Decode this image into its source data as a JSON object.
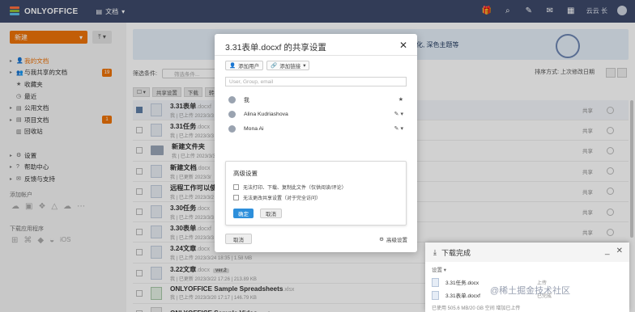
{
  "topbar": {
    "logo": "ONLYOFFICE",
    "module": "文档",
    "user": "云云 长"
  },
  "sidebar": {
    "new_button": "新建",
    "items": [
      {
        "label": "我的文档",
        "active": true,
        "arrow": "▸",
        "icon": "👤"
      },
      {
        "label": "与我共享的文档",
        "badge": "19",
        "arrow": "▸",
        "icon": "👥"
      },
      {
        "label": "收藏夹",
        "arrow": "",
        "icon": "★"
      },
      {
        "label": "最近",
        "arrow": "",
        "icon": "◷"
      },
      {
        "label": "公用文档",
        "arrow": "▸",
        "icon": "▤"
      },
      {
        "label": "项目文档",
        "badge": "1",
        "arrow": "▸",
        "icon": "▤"
      },
      {
        "label": "回收站",
        "arrow": "",
        "icon": "▥"
      },
      {
        "label": "",
        "arrow": "",
        "icon": ""
      },
      {
        "label": "设置",
        "arrow": "▸",
        "icon": "⚙"
      },
      {
        "label": "帮助中心",
        "arrow": "▸",
        "icon": "?"
      },
      {
        "label": "反馈与支持",
        "arrow": "▸",
        "icon": "✉"
      }
    ],
    "add_account_title": "添加帐户",
    "download_apps_title": "下载应用程序"
  },
  "banner": {
    "text": "化, 深色主题等"
  },
  "filter": {
    "label": "筛选条件:",
    "placeholder": "筛选条件...",
    "sort": "排序方式: 上次修改日期"
  },
  "toolbar": [
    "",
    "共享设置",
    "下载",
    "转换"
  ],
  "files": [
    {
      "name": "3.31表单",
      "ext": ".docxf",
      "meta": "我 | 已上传 2023/3/3",
      "share": "共享",
      "type": "doc",
      "selected": true
    },
    {
      "name": "3.31任务",
      "ext": ".docx",
      "meta": "我 | 已上传 2023/3/3",
      "share": "共享",
      "type": "doc"
    },
    {
      "name": "新建文件夹",
      "ext": "",
      "meta": "我 | 已上传 2023/3/3",
      "share": "共享",
      "type": "folder"
    },
    {
      "name": "新建文档",
      "ext": ".docx",
      "meta": "我 | 已更新 2023/3/",
      "share": "共享",
      "type": "doc"
    },
    {
      "name": "远程工作可以使",
      "ext": "",
      "meta": "我 | 已上传 2023/3/2",
      "share": "共享",
      "type": "doc"
    },
    {
      "name": "3.30任务",
      "ext": ".docx",
      "meta": "我 | 已上传 2023/3/3",
      "share": "共享",
      "type": "doc"
    },
    {
      "name": "3.30表单",
      "ext": ".docxf",
      "meta": "我 | 已上传 2023/3/3",
      "share": "共享",
      "type": "doc"
    },
    {
      "name": "3.24文章",
      "ext": ".docx",
      "meta": "我 | 已上传 2023/3/24 18:35 | 1.58 MB",
      "share": "共享",
      "type": "doc"
    },
    {
      "name": "3.22文章",
      "ext": ".docx",
      "meta": "我 | 已更新 2023/3/22 17:26 | 213.89 KB",
      "share": "共享",
      "type": "doc",
      "ver": "ver.2"
    },
    {
      "name": "ONLYOFFICE Sample Spreadsheets",
      "ext": ".xlsx",
      "meta": "我 | 已上传 2023/3/20 17:17 | 146.79 KB",
      "share": "共享",
      "type": "sheet"
    },
    {
      "name": "ONLYOFFICE Sample Video",
      "ext": ".mp4",
      "meta": "",
      "share": "",
      "type": "video"
    }
  ],
  "dialog": {
    "title": "3.31表单.docxf 的共享设置",
    "add_user": "添加用户",
    "add_link": "添加链接",
    "input_placeholder": "User, Group, email",
    "people": [
      {
        "name": "我",
        "right": "★"
      },
      {
        "name": "Alina Kudriashova",
        "right": "✎ ▾"
      },
      {
        "name": "Mona Ai",
        "right": "✎ ▾"
      }
    ],
    "advanced": {
      "title": "高级设置",
      "opt1": "无法打印、下载、复制此文件（仅供阅读/评论）",
      "opt2": "无法更改共享设置（对于完全访问）",
      "ok": "确定",
      "cancel": "取消"
    },
    "cancel": "取消",
    "advanced_link": "高级设置"
  },
  "upload": {
    "title": "下载完成",
    "settings": "设置",
    "files": [
      {
        "name": "3.31任务.docx",
        "state": "上传"
      },
      {
        "name": "3.31表单.docxf",
        "state": "已完成"
      }
    ],
    "footer": "已使用 505.6 MB/20 GB 空间   增加已上传"
  },
  "watermark": "@稀土掘金技术社区"
}
